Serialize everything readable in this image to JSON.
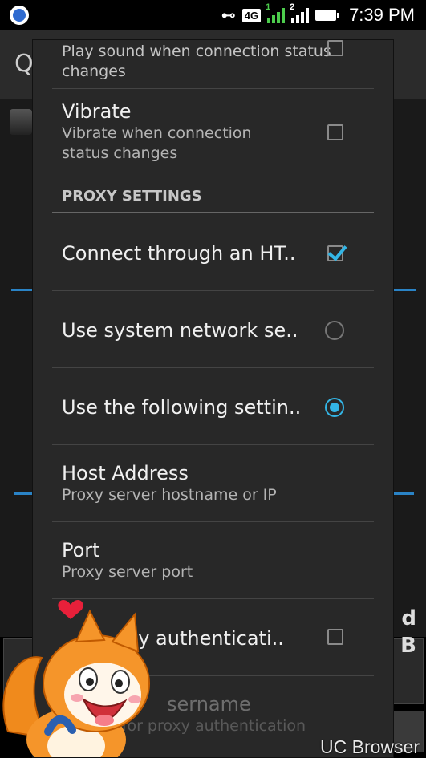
{
  "status_bar": {
    "time": "7:39 PM",
    "network": "4G",
    "sim1": "1",
    "sim2": "2",
    "icons": [
      "app-notification-icon",
      "key-icon",
      "signal-icon",
      "battery-icon"
    ]
  },
  "background_app": {
    "title_initial": "Q",
    "right_letter_top": "d",
    "right_letter_bottom": "B",
    "accent_color": "#2a83c6"
  },
  "dialog": {
    "items": [
      {
        "title": "",
        "summary": "Play sound when connection status changes",
        "control": "checkbox",
        "checked": false
      },
      {
        "title": "Vibrate",
        "summary": "Vibrate when connection status changes",
        "control": "checkbox",
        "checked": false
      }
    ],
    "proxy_section": "PROXY SETTINGS",
    "proxy_items": [
      {
        "title": "Connect through an HT..",
        "control": "checkbox",
        "checked": true
      },
      {
        "title": "Use system network se..",
        "control": "radio",
        "selected": false
      },
      {
        "title": "Use the following settin..",
        "control": "radio",
        "selected": true
      },
      {
        "title": "Host Address",
        "summary": "Proxy server hostname or IP"
      },
      {
        "title": "Port",
        "summary": "Proxy server port"
      },
      {
        "title": "xy authenticati..",
        "control": "checkbox",
        "checked": false
      },
      {
        "title": "sername",
        "summary": "ne for proxy authentication"
      }
    ],
    "accent_color": "#33b5e5"
  },
  "overlay": {
    "brand_label": "UC Browser",
    "mascot": "uc-squirrel-mascot"
  }
}
